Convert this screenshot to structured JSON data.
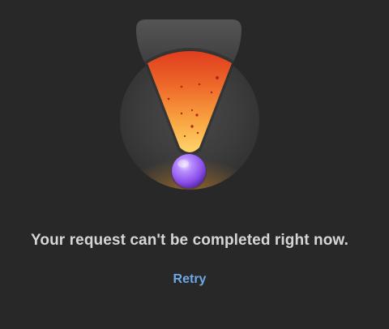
{
  "error": {
    "message": "Your request can't be completed right now.",
    "retry_label": "Retry",
    "illustration_icon": "broken-funnel-icon"
  },
  "colors": {
    "background": "#282828",
    "message_text": "#d6d6d6",
    "link": "#6ea8e6",
    "lava_top": "#e03d1e",
    "lava_bottom": "#ffd46a",
    "orb": "#a064ff"
  }
}
